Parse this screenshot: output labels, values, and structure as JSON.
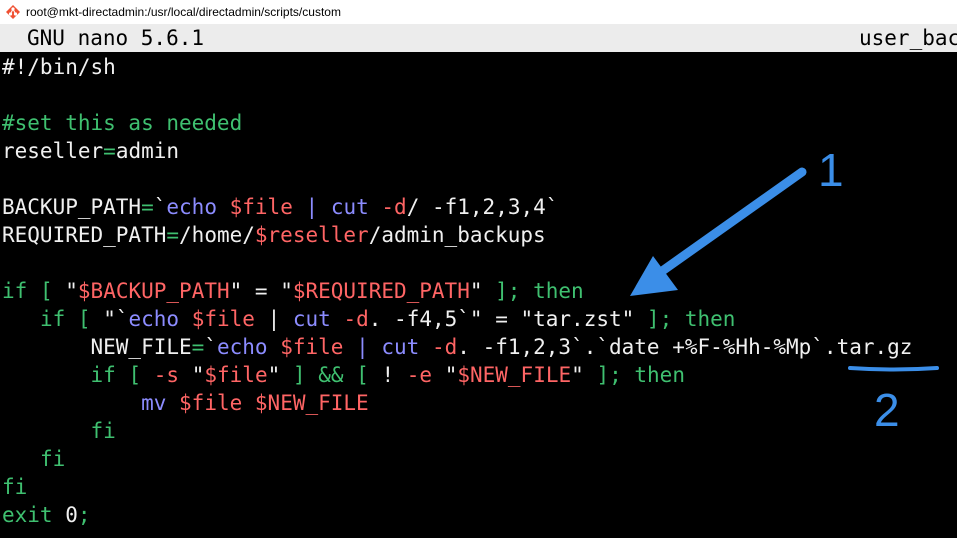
{
  "window": {
    "title": "root@mkt-directadmin:/usr/local/directadmin/scripts/custom",
    "icon": "terminal-app-icon"
  },
  "nano": {
    "version": "GNU nano 5.6.1",
    "filename": "user_bac"
  },
  "colors": {
    "comment_keyword": "#3fc070",
    "variable": "#ff6565",
    "command": "#8c8cff",
    "text": "#f0f0f0",
    "annotation": "#3b8ee8"
  },
  "lines": [
    [
      {
        "t": "#!/bin/sh",
        "c": "text"
      }
    ],
    [],
    [
      {
        "t": "#set this as needed",
        "c": "cmt"
      }
    ],
    [
      {
        "t": "reseller",
        "c": "text"
      },
      {
        "t": "=",
        "c": "op"
      },
      {
        "t": "admin",
        "c": "text"
      }
    ],
    [],
    [
      {
        "t": "BACKUP_PATH",
        "c": "text"
      },
      {
        "t": "=",
        "c": "op"
      },
      {
        "t": "`",
        "c": "text"
      },
      {
        "t": "echo",
        "c": "cmd"
      },
      {
        "t": " ",
        "c": "text"
      },
      {
        "t": "$file",
        "c": "var"
      },
      {
        "t": " ",
        "c": "text"
      },
      {
        "t": "|",
        "c": "cmd"
      },
      {
        "t": " ",
        "c": "text"
      },
      {
        "t": "cut",
        "c": "cmd"
      },
      {
        "t": " ",
        "c": "text"
      },
      {
        "t": "-d",
        "c": "opt"
      },
      {
        "t": "/ -f1,2,3,4`",
        "c": "text"
      }
    ],
    [
      {
        "t": "REQUIRED_PATH",
        "c": "text"
      },
      {
        "t": "=",
        "c": "op"
      },
      {
        "t": "/home/",
        "c": "text"
      },
      {
        "t": "$reseller",
        "c": "var"
      },
      {
        "t": "/admin_backups",
        "c": "text"
      }
    ],
    [],
    [
      {
        "t": "if",
        "c": "kw"
      },
      {
        "t": " ",
        "c": "text"
      },
      {
        "t": "[",
        "c": "kw"
      },
      {
        "t": " \"",
        "c": "text"
      },
      {
        "t": "$BACKUP_PATH",
        "c": "var"
      },
      {
        "t": "\" = \"",
        "c": "text"
      },
      {
        "t": "$REQUIRED_PATH",
        "c": "var"
      },
      {
        "t": "\" ",
        "c": "text"
      },
      {
        "t": "];",
        "c": "kw"
      },
      {
        "t": " ",
        "c": "text"
      },
      {
        "t": "then",
        "c": "kw"
      }
    ],
    [
      {
        "t": "   ",
        "c": "text"
      },
      {
        "t": "if",
        "c": "kw"
      },
      {
        "t": " ",
        "c": "text"
      },
      {
        "t": "[",
        "c": "kw"
      },
      {
        "t": " \"`",
        "c": "text"
      },
      {
        "t": "echo",
        "c": "cmd"
      },
      {
        "t": " ",
        "c": "text"
      },
      {
        "t": "$file",
        "c": "var"
      },
      {
        "t": " | ",
        "c": "text"
      },
      {
        "t": "cut",
        "c": "cmd"
      },
      {
        "t": " ",
        "c": "text"
      },
      {
        "t": "-d",
        "c": "opt"
      },
      {
        "t": ". -f4,5`\" = \"tar.zst\" ",
        "c": "text"
      },
      {
        "t": "];",
        "c": "kw"
      },
      {
        "t": " ",
        "c": "text"
      },
      {
        "t": "then",
        "c": "kw"
      }
    ],
    [
      {
        "t": "       NEW_FILE",
        "c": "text"
      },
      {
        "t": "=",
        "c": "op"
      },
      {
        "t": "`",
        "c": "text"
      },
      {
        "t": "echo",
        "c": "cmd"
      },
      {
        "t": " ",
        "c": "text"
      },
      {
        "t": "$file",
        "c": "var"
      },
      {
        "t": " ",
        "c": "text"
      },
      {
        "t": "|",
        "c": "cmd"
      },
      {
        "t": " ",
        "c": "text"
      },
      {
        "t": "cut",
        "c": "cmd"
      },
      {
        "t": " ",
        "c": "text"
      },
      {
        "t": "-d",
        "c": "opt"
      },
      {
        "t": ". -f1,2,3`.`date +%F-%Hh-%Mp`.tar.gz",
        "c": "text"
      }
    ],
    [
      {
        "t": "       ",
        "c": "text"
      },
      {
        "t": "if",
        "c": "kw"
      },
      {
        "t": " ",
        "c": "text"
      },
      {
        "t": "[",
        "c": "kw"
      },
      {
        "t": " ",
        "c": "text"
      },
      {
        "t": "-s",
        "c": "opt"
      },
      {
        "t": " \"",
        "c": "text"
      },
      {
        "t": "$file",
        "c": "var"
      },
      {
        "t": "\" ",
        "c": "text"
      },
      {
        "t": "]",
        "c": "kw"
      },
      {
        "t": " ",
        "c": "text"
      },
      {
        "t": "&&",
        "c": "kw"
      },
      {
        "t": " ",
        "c": "text"
      },
      {
        "t": "[",
        "c": "kw"
      },
      {
        "t": " ! ",
        "c": "text"
      },
      {
        "t": "-e",
        "c": "opt"
      },
      {
        "t": " \"",
        "c": "text"
      },
      {
        "t": "$NEW_FILE",
        "c": "var"
      },
      {
        "t": "\" ",
        "c": "text"
      },
      {
        "t": "];",
        "c": "kw"
      },
      {
        "t": " ",
        "c": "text"
      },
      {
        "t": "then",
        "c": "kw"
      }
    ],
    [
      {
        "t": "           ",
        "c": "text"
      },
      {
        "t": "mv",
        "c": "cmd"
      },
      {
        "t": " ",
        "c": "text"
      },
      {
        "t": "$file",
        "c": "var"
      },
      {
        "t": " ",
        "c": "text"
      },
      {
        "t": "$NEW_FILE",
        "c": "var"
      }
    ],
    [
      {
        "t": "       ",
        "c": "text"
      },
      {
        "t": "fi",
        "c": "kw"
      }
    ],
    [
      {
        "t": "   ",
        "c": "text"
      },
      {
        "t": "fi",
        "c": "kw"
      }
    ],
    [
      {
        "t": "fi",
        "c": "kw"
      }
    ],
    [
      {
        "t": "exit",
        "c": "kw"
      },
      {
        "t": " 0",
        "c": "text"
      },
      {
        "t": ";",
        "c": "kw"
      }
    ]
  ],
  "annotations": {
    "arrow_label": "1",
    "underline_label": "2"
  }
}
